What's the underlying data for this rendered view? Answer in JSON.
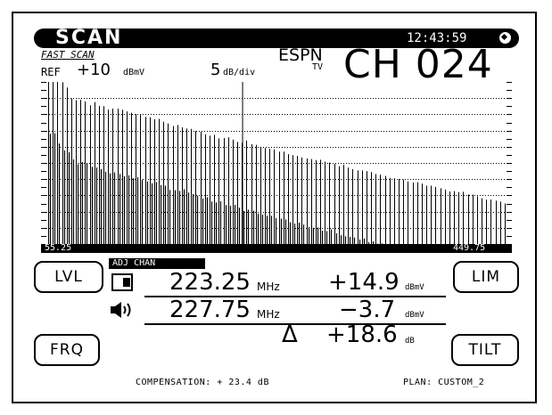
{
  "header": {
    "mode": "SCAN",
    "clock": "12:43:59",
    "clock_icon": "clock-icon"
  },
  "scan": {
    "sweep_type": "FAST SCAN",
    "ref_label": "REF",
    "ref_value": "+10",
    "ref_unit": "dBmV",
    "scale_value": "5",
    "scale_unit": "dB/div",
    "network": "ESPN",
    "network_sub": "TV",
    "channel": "CH 024",
    "freq_start": "55.25",
    "freq_end": "449.75"
  },
  "softkeys": {
    "lvl": "LVL",
    "lim": "LIM",
    "frq": "FRQ",
    "tilt": "TILT"
  },
  "measure": {
    "adj_label": "ADJ CHAN",
    "video_icon": "video-carrier-icon",
    "video_freq": "223.25",
    "video_freq_unit": "MHz",
    "video_level": "+14.9",
    "video_level_unit": "dBmV",
    "audio_icon": "speaker-icon",
    "audio_freq": "227.75",
    "audio_freq_unit": "MHz",
    "audio_level": "−3.7",
    "audio_level_unit": "dBmV",
    "delta_symbol": "Δ",
    "delta_value": "+18.6",
    "delta_unit": "dB"
  },
  "footer": {
    "compensation": "COMPENSATION: + 23.4 dB",
    "plan": "PLAN: CUSTOM_2"
  },
  "chart_data": {
    "type": "bar",
    "ref_level_dBmV": 10,
    "scale_dB_per_div": 5,
    "divisions": 10,
    "x_range_MHz": [
      55.25,
      449.75
    ],
    "grid": "on",
    "marker_MHz": 223.25,
    "series": [
      {
        "values": [
          15.5,
          16.5,
          14.0,
          9.9,
          8.3,
          4.9,
          4.4,
          4.5,
          4.0,
          2.8,
          3.8,
          2.6,
          2.5,
          1.5,
          1.8,
          1.8,
          1.4,
          0.9,
          0.5,
          0.1,
          -0.1,
          -0.8,
          -0.9,
          -1.5,
          -1.4,
          -2.3,
          -2.8,
          -3.6,
          -3.3,
          -4.0,
          -4.4,
          -4.5,
          -5.1,
          -5.4,
          -6.1,
          -6.6,
          -6.3,
          -7.4,
          -7.3,
          -7.1,
          -7.8,
          -8.5,
          -8.8,
          -8.1,
          -9.2,
          -9.4,
          -10.0,
          -10.4,
          -10.6,
          -10.8,
          -11.5,
          -11.5,
          -12.3,
          -12.6,
          -12.8,
          -13.3,
          -13.6,
          -13.8,
          -14.1,
          -14.0,
          -14.6,
          -14.9,
          -15.3,
          -16.0,
          -15.5,
          -16.4,
          -16.9,
          -17.3,
          -17.3,
          -17.5,
          -17.8,
          -18.4,
          -18.6,
          -19.0,
          -19.6,
          -19.7,
          -19.9,
          -20.1,
          -20.7,
          -21.0,
          -20.9,
          -21.4,
          -22.0,
          -22.0,
          -22.4,
          -22.8,
          -23.2,
          -23.8,
          -23.7,
          -24.0,
          -23.9,
          -24.7,
          -24.8,
          -25.3,
          -25.9,
          -26.3,
          -26.3,
          -26.6,
          -26.9,
          -27.5
        ]
      },
      {
        "values": [
          -6.0,
          -5.8,
          -9.0,
          -11.1,
          -11.7,
          -13.9,
          -15.4,
          -14.7,
          -15.0,
          -16.2,
          -16.4,
          -16.9,
          -17.7,
          -18.2,
          -17.9,
          -18.4,
          -19.1,
          -18.8,
          -19.7,
          -19.4,
          -20.2,
          -20.7,
          -21.3,
          -20.9,
          -21.8,
          -22.0,
          -23.3,
          -23.4,
          -23.6,
          -23.1,
          -24.1,
          -24.6,
          -25.1,
          -26.0,
          -25.6,
          -26.9,
          -27.2,
          -26.8,
          -28.0,
          -28.2,
          -27.9,
          -28.8,
          -29.8,
          -29.4,
          -29.7,
          -30.7,
          -30.9,
          -31.3,
          -31.3,
          -32.0,
          -32.2,
          -32.4,
          -33.3,
          -33.7,
          -33.4,
          -34.0,
          -34.8,
          -35.0,
          -34.9,
          -35.9,
          -36.0,
          -35.5,
          -36.7,
          -37.3,
          -37.6,
          -37.8,
          -38.0,
          -38.6,
          -38.3,
          -39.4,
          -39.2,
          -39.9,
          -39.8,
          -40.1,
          -40.7,
          -40.9,
          -41.6,
          -41.7,
          -42.0,
          -42.5,
          -42.7,
          -43.0,
          -43.8,
          -43.6,
          -44.4,
          -44.5,
          -44.8,
          -45.2,
          -45.3,
          -46.2,
          -46.5,
          -46.3,
          -47.3,
          -47.5,
          -48.0,
          -48.1,
          -48.8,
          -49.2,
          -49.0,
          -50.0
        ]
      }
    ]
  }
}
